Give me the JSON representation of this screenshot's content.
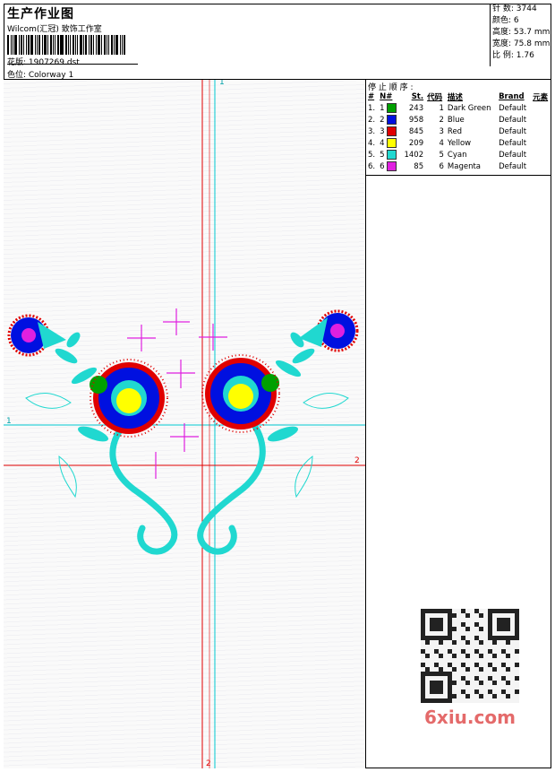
{
  "header": {
    "title": "生产作业图",
    "company": "Wilcom(汇冠) 致饰工作室",
    "file": "花版: 1907269.dst",
    "colorway": "色位: Colorway 1"
  },
  "stats": [
    {
      "label": "针 数",
      "value": "3744"
    },
    {
      "label": "颜色",
      "value": "6"
    },
    {
      "label": "高度",
      "value": "53.7 mm"
    },
    {
      "label": "宽度",
      "value": "75.8 mm"
    },
    {
      "label": "比 例",
      "value": "1.76"
    }
  ],
  "stop_sequence": {
    "title": "停 止 顺 序 :",
    "columns": [
      "#",
      "N#",
      "St.",
      "代码",
      "描述",
      "Brand",
      "元素"
    ],
    "rows": [
      {
        "n": "1.",
        "nn": "1",
        "color": "#00a000",
        "st": "243",
        "code": "1",
        "desc": "Dark Green",
        "brand": "Default"
      },
      {
        "n": "2.",
        "nn": "2",
        "color": "#0010e0",
        "st": "958",
        "code": "2",
        "desc": "Blue",
        "brand": "Default"
      },
      {
        "n": "3.",
        "nn": "3",
        "color": "#e00000",
        "st": "845",
        "code": "3",
        "desc": "Red",
        "brand": "Default"
      },
      {
        "n": "4.",
        "nn": "4",
        "color": "#ffff00",
        "st": "209",
        "code": "4",
        "desc": "Yellow",
        "brand": "Default"
      },
      {
        "n": "5.",
        "nn": "5",
        "color": "#20d8d0",
        "st": "1402",
        "code": "5",
        "desc": "Cyan",
        "brand": "Default"
      },
      {
        "n": "6.",
        "nn": "6",
        "color": "#e020e0",
        "st": "85",
        "code": "6",
        "desc": "Magenta",
        "brand": "Default"
      }
    ]
  },
  "guides": {
    "cyan_top": "1",
    "cyan_left": "1",
    "red_right": "2",
    "red_bottom": "2"
  },
  "colors": {
    "cyan_guide": "#00c8d0",
    "red_guide": "#e00000",
    "watermark": "#e46a6a"
  },
  "watermark": "6xiu.com"
}
